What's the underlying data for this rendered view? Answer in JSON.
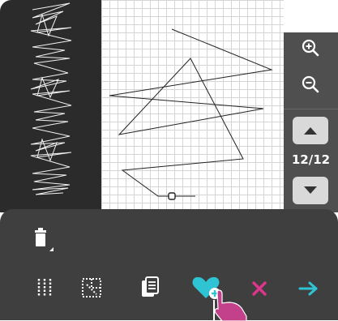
{
  "page_counter": "12/12",
  "icons": {
    "zoom_in": "zoom-in-icon",
    "zoom_out": "zoom-out-icon",
    "page_up": "triangle-up-icon",
    "page_down": "triangle-down-icon",
    "delete": "trash-icon",
    "stitch_columns": "vertical-dotted-lines-icon",
    "select_region": "dotted-selection-icon",
    "copy": "copy-pages-icon",
    "favorite_add": "heart-plus-icon",
    "close": "x-icon",
    "next": "arrow-right-icon"
  },
  "colors": {
    "preview_bg": "#2b2b2b",
    "panel_bg": "#4f4f4f",
    "toolbar_bg": "#3f3f3f",
    "accent_teal": "#2fc4d4",
    "accent_magenta": "#e0358f",
    "hand_pink": "#c3418a"
  }
}
